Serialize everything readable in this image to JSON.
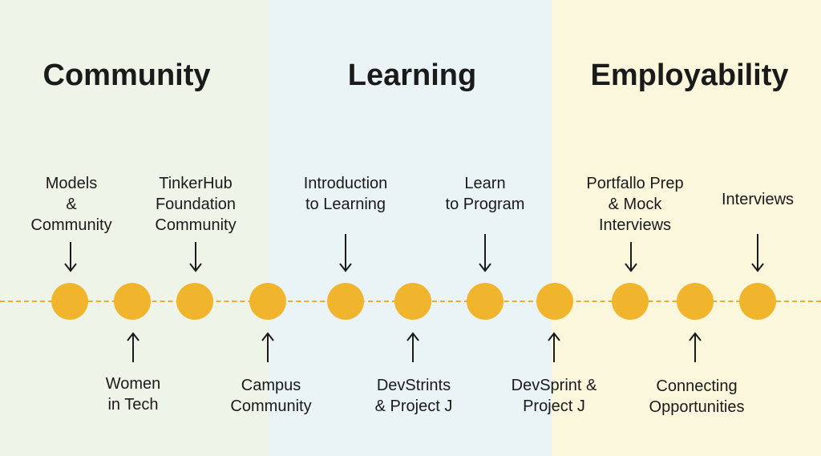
{
  "sections": {
    "community": {
      "title": "Community",
      "color": "#eef5e8"
    },
    "learning": {
      "title": "Learning",
      "color": "#eaf3f5"
    },
    "employability": {
      "title": "Employability",
      "color": "#fbf7dd"
    }
  },
  "timeline": {
    "dash_color": "#e8ad2c",
    "node_color": "#f0b42d"
  },
  "milestones_above": [
    {
      "lines": [
        "Models",
        "&",
        "Community"
      ]
    },
    {
      "lines": [
        "TinkerHub",
        "Foundation",
        "Community"
      ]
    },
    {
      "lines": [
        "Introduction",
        "to Learning"
      ]
    },
    {
      "lines": [
        "Learn",
        "to Program"
      ]
    },
    {
      "lines": [
        "Portfallo Prep",
        "& Mock",
        "Interviews"
      ]
    },
    {
      "lines": [
        "Interviews"
      ]
    }
  ],
  "milestones_below": [
    {
      "lines": [
        "Women",
        "in Tech"
      ]
    },
    {
      "lines": [
        "Campus",
        "Community"
      ]
    },
    {
      "lines": [
        "DevStrints",
        "& Project J"
      ]
    },
    {
      "lines": [
        "DevSprint &",
        "Project J"
      ]
    },
    {
      "lines": [
        "Connecting",
        "Opportunities"
      ]
    }
  ]
}
